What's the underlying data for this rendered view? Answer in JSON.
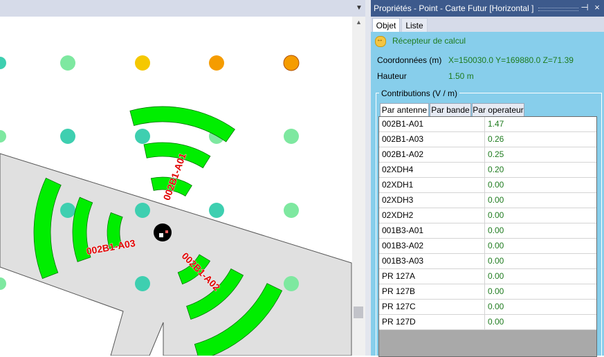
{
  "window": {
    "title": "Propriétés - Point - Carte Futur [Horizontal ]",
    "pin_glyph": "⊣",
    "close_glyph": "×"
  },
  "tabs": [
    {
      "label": "Objet",
      "active": true
    },
    {
      "label": "Liste",
      "active": false
    }
  ],
  "object": {
    "type_label": "Récepteur de calcul",
    "type_icon": "receiver-icon",
    "coord_label": "Coordonnées (m)",
    "coord_value": "X=150030.0  Y=169880.0  Z=71.39",
    "height_label": "Hauteur",
    "height_value": "1.50 m"
  },
  "contributions": {
    "legend": "Contributions (V / m)",
    "subtabs": [
      {
        "label": "Par antenne",
        "active": true
      },
      {
        "label": "Par bande",
        "active": false
      },
      {
        "label": "Par operateur",
        "active": false
      }
    ],
    "rows": [
      {
        "name": "002B1-A01",
        "value": "1.47"
      },
      {
        "name": "002B1-A03",
        "value": "0.26"
      },
      {
        "name": "002B1-A02",
        "value": "0.25"
      },
      {
        "name": "02XDH4",
        "value": "0.20"
      },
      {
        "name": "02XDH1",
        "value": "0.00"
      },
      {
        "name": "02XDH3",
        "value": "0.00"
      },
      {
        "name": "02XDH2",
        "value": "0.00"
      },
      {
        "name": "001B3-A01",
        "value": "0.00"
      },
      {
        "name": "001B3-A02",
        "value": "0.00"
      },
      {
        "name": "001B3-A03",
        "value": "0.00"
      },
      {
        "name": "PR 127A",
        "value": "0.00"
      },
      {
        "name": "PR 127B",
        "value": "0.00"
      },
      {
        "name": "PR 127C",
        "value": "0.00"
      },
      {
        "name": "PR 127D",
        "value": "0.00"
      }
    ]
  },
  "map": {
    "antenna_labels": [
      "002B1-A01",
      "002B1-A03",
      "002B1-A02"
    ],
    "colors": {
      "sector_fill": "#00ee00",
      "sector_stroke": "#007700",
      "label_color": "#e00000",
      "building_fill": "#e0e0e0",
      "point_teal": "#3ecfb0",
      "point_green": "#7ee8a0",
      "point_yellow": "#f5c800",
      "point_orange": "#f59c00"
    }
  }
}
